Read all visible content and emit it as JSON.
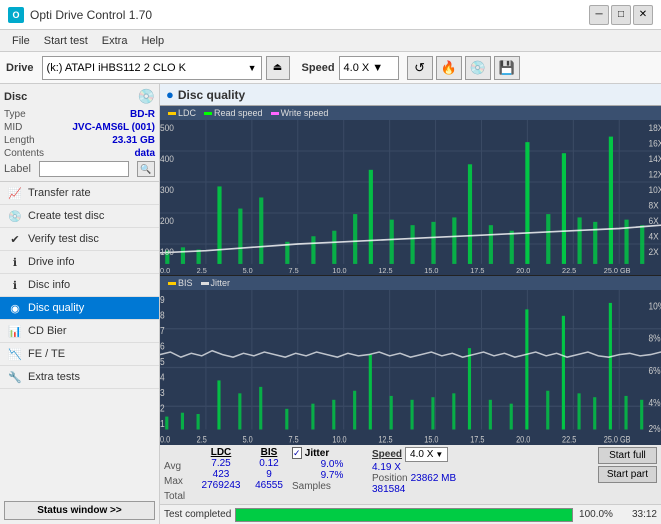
{
  "titleBar": {
    "title": "Opti Drive Control 1.70",
    "minBtn": "─",
    "maxBtn": "□",
    "closeBtn": "✕"
  },
  "menuBar": {
    "items": [
      "File",
      "Start test",
      "Extra",
      "Help"
    ]
  },
  "driveBar": {
    "label": "Drive",
    "driveText": "(k:)  ATAPI iHBS112  2 CLO K",
    "speedLabel": "Speed",
    "speedValue": "4.0 X ▼",
    "ejectIcon": "⏏"
  },
  "discSection": {
    "title": "Disc",
    "typeLabel": "Type",
    "typeValue": "BD-R",
    "midLabel": "MID",
    "midValue": "JVC-AMS6L (001)",
    "lengthLabel": "Length",
    "lengthValue": "23.31 GB",
    "contentsLabel": "Contents",
    "contentsValue": "data",
    "labelLabel": "Label",
    "labelValue": ""
  },
  "nav": {
    "items": [
      {
        "id": "transfer-rate",
        "label": "Transfer rate",
        "icon": "📈"
      },
      {
        "id": "create-test-disc",
        "label": "Create test disc",
        "icon": "💿"
      },
      {
        "id": "verify-test-disc",
        "label": "Verify test disc",
        "icon": "✔"
      },
      {
        "id": "drive-info",
        "label": "Drive info",
        "icon": "ℹ"
      },
      {
        "id": "disc-info",
        "label": "Disc info",
        "icon": "ℹ"
      },
      {
        "id": "disc-quality",
        "label": "Disc quality",
        "icon": "◉",
        "active": true
      },
      {
        "id": "cd-bier",
        "label": "CD Bier",
        "icon": "📊"
      },
      {
        "id": "fe-te",
        "label": "FE / TE",
        "icon": "📉"
      },
      {
        "id": "extra-tests",
        "label": "Extra tests",
        "icon": "🔧"
      }
    ]
  },
  "statusBtn": "Status window >>",
  "statusBar": {
    "text": "Test completed",
    "progress": 100,
    "time": "33:12"
  },
  "chartSection": {
    "title": "Disc quality",
    "topLegend": {
      "ldc": "LDC",
      "read": "Read speed",
      "write": "Write speed"
    },
    "bottomLegend": {
      "bis": "BIS",
      "jitter": "Jitter"
    },
    "topYLeft": [
      "500",
      "400",
      "300",
      "200",
      "100",
      "0"
    ],
    "topYRight": [
      "18X",
      "16X",
      "14X",
      "12X",
      "10X",
      "8X",
      "6X",
      "4X",
      "2X"
    ],
    "bottomYLeft": [
      "9",
      "8",
      "7",
      "6",
      "5",
      "4",
      "3",
      "2",
      "1"
    ],
    "bottomYRight": [
      "10%",
      "8%",
      "6%",
      "4%",
      "2%"
    ],
    "xLabels": [
      "0.0",
      "2.5",
      "5.0",
      "7.5",
      "10.0",
      "12.5",
      "15.0",
      "17.5",
      "20.0",
      "22.5",
      "25.0 GB"
    ]
  },
  "statsSection": {
    "headers": {
      "ldc": "LDC",
      "bis": "BIS",
      "jitter": "Jitter",
      "speed": "Speed",
      "speedDropdown": "4.0 X"
    },
    "rows": {
      "avg": {
        "label": "Avg",
        "ldc": "7.25",
        "bis": "0.12",
        "jitterChecked": true,
        "jitter": "9.0%",
        "speedLabel": "4.19 X"
      },
      "max": {
        "label": "Max",
        "ldc": "423",
        "bis": "9",
        "jitter": "9.7%",
        "positionLabel": "Position",
        "positionValue": "23862 MB"
      },
      "total": {
        "label": "Total",
        "ldc": "2769243",
        "bis": "46555",
        "samplesLabel": "Samples",
        "samplesValue": "381584"
      }
    },
    "buttons": {
      "startFull": "Start full",
      "startPart": "Start part"
    }
  }
}
